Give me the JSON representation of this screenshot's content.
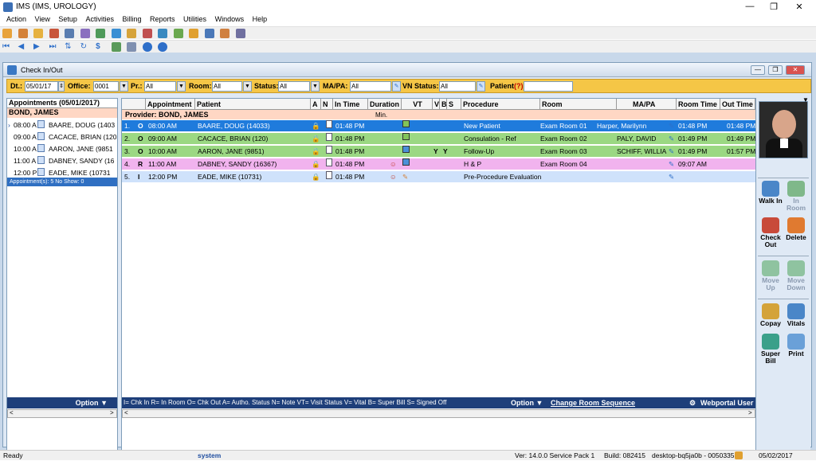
{
  "app": {
    "title": "IMS (IMS, UROLOGY)"
  },
  "menu": [
    "Action",
    "View",
    "Setup",
    "Activities",
    "Billing",
    "Reports",
    "Utilities",
    "Windows",
    "Help"
  ],
  "window": {
    "title": "Check In/Out"
  },
  "filters": {
    "dt_label": "Dt.:",
    "dt_value": "05/01/17",
    "office_label": "Office:",
    "office_value": "0001",
    "pr_label": "Pr.:",
    "pr_value": "All",
    "room_label": "Room:",
    "room_value": "All",
    "status_label": "Status:",
    "status_value": "All",
    "mapa_label": "MA/PA:",
    "mapa_value": "All",
    "vn_label": "VN Status:",
    "vn_value": "All",
    "patient_label": "Patient",
    "patient_q": "(?)",
    "patient_value": ""
  },
  "left": {
    "header": "Appointments (05/01/2017)",
    "provider": "BOND, JAMES",
    "rows": [
      {
        "time": "08:00 A",
        "name": "BAARE, DOUG (1403"
      },
      {
        "time": "09:00 A",
        "name": "CACACE, BRIAN (120"
      },
      {
        "time": "10:00 A",
        "name": "AARON, JANE (9851"
      },
      {
        "time": "11:00 A",
        "name": "DABNEY, SANDY (16"
      },
      {
        "time": "12:00 P",
        "name": "EADE, MIKE (10731"
      }
    ],
    "summary": "Appointment(s): 5   No Show: 0",
    "option": "Option"
  },
  "grid": {
    "headers": {
      "appointment": "Appointment",
      "patient": "Patient",
      "a": "A",
      "n": "N",
      "intime": "In Time",
      "duration": "Duration",
      "vt": "VT",
      "v": "V",
      "b": "B",
      "s": "S",
      "procedure": "Procedure",
      "room": "Room",
      "mapa": "MA/PA",
      "roomtime": "Room Time",
      "outtime": "Out Time"
    },
    "provider": "Provider: BOND, JAMES",
    "min": "Min.",
    "rows": [
      {
        "num": "1.",
        "st": "O",
        "appt": "08:00 AM",
        "patient": "BAARE, DOUG  (14033)",
        "intime": "01:48 PM",
        "v": "",
        "b": "",
        "procedure": "New Patient",
        "room": "Exam Room 01",
        "mapa": "Harper, Marilynn",
        "roomtime": "01:48 PM",
        "outtime": "01:48 PM"
      },
      {
        "num": "2.",
        "st": "O",
        "appt": "09:00 AM",
        "patient": "CACACE, BRIAN  (120)",
        "intime": "01:48 PM",
        "v": "",
        "b": "",
        "procedure": "Consulation - Ref",
        "room": "Exam Room 02",
        "mapa": "PALY, DAVID",
        "roomtime": "01:49 PM",
        "outtime": "01:49 PM"
      },
      {
        "num": "3.",
        "st": "O",
        "appt": "10:00 AM",
        "patient": "AARON, JANE  (9851)",
        "intime": "01:48 PM",
        "v": "Y",
        "b": "Y",
        "procedure": "Follow-Up",
        "room": "Exam Room 03",
        "mapa": "SCHIFF, WILLIA",
        "roomtime": "01:49 PM",
        "outtime": "01:57 PM"
      },
      {
        "num": "4.",
        "st": "R",
        "appt": "11:00 AM",
        "patient": "DABNEY, SANDY  (16367)",
        "intime": "01:48 PM",
        "v": "",
        "b": "",
        "procedure": "H & P",
        "room": "Exam Room 04",
        "mapa": "",
        "roomtime": "09:07 AM",
        "outtime": ""
      },
      {
        "num": "5.",
        "st": "I",
        "appt": "12:00 PM",
        "patient": "EADE, MIKE  (10731)",
        "intime": "01:48 PM",
        "v": "",
        "b": "",
        "procedure": "Pre-Procedure Evaluation",
        "room": "",
        "mapa": "",
        "roomtime": "",
        "outtime": ""
      }
    ],
    "legend": "I= Chk In  R= In Room O= Chk Out  A= Autho. Status  N= Note  VT= Visit Status  V= Vital  B= Super Bill  S= Signed Off",
    "option": "Option",
    "change_room": "Change Room Sequence",
    "webportal": "Webportal User"
  },
  "actions": {
    "walkin": "Walk In",
    "inroom": "In Room",
    "checkout": "Check Out",
    "delete": "Delete",
    "moveup": "Move Up",
    "movedown": "Move Down",
    "copay": "Copay",
    "vitals": "Vitals",
    "superbill": "Super Bill",
    "print": "Print"
  },
  "status": {
    "ready": "Ready",
    "user": "system",
    "version": "Ver: 14.0.0 Service Pack 1",
    "build": "Build: 082415",
    "machine": "desktop-bq5ja0b - 0050335",
    "date": "05/02/2017"
  }
}
